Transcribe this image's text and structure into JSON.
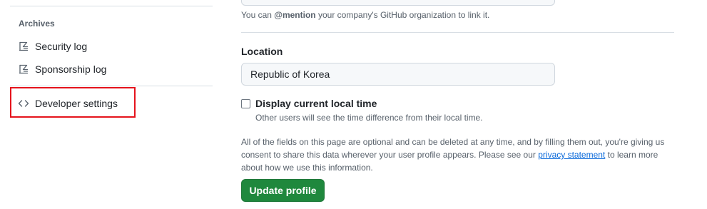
{
  "sidebar": {
    "archives_heading": "Archives",
    "items": [
      {
        "label": "Security log",
        "icon": "log-icon"
      },
      {
        "label": "Sponsorship log",
        "icon": "log-icon"
      }
    ],
    "developer_settings": {
      "label": "Developer settings",
      "icon": "code-icon"
    }
  },
  "company": {
    "hint_prefix": "You can ",
    "hint_mention": "@mention",
    "hint_suffix": " your company's GitHub organization to link it."
  },
  "location": {
    "label": "Location",
    "value": "Republic of Korea"
  },
  "local_time": {
    "label": "Display current local time",
    "note": "Other users will see the time difference from their local time.",
    "checked": false
  },
  "privacy": {
    "text_before": "All of the fields on this page are optional and can be deleted at any time, and by filling them out, you're giving us consent to share this data wherever your user profile appears. Please see our ",
    "link": "privacy statement",
    "text_after": " to learn more about how we use this information."
  },
  "update_button": "Update profile",
  "colors": {
    "primary_button": "#1f883d",
    "link": "#0969da",
    "highlight": "#e5131c"
  }
}
